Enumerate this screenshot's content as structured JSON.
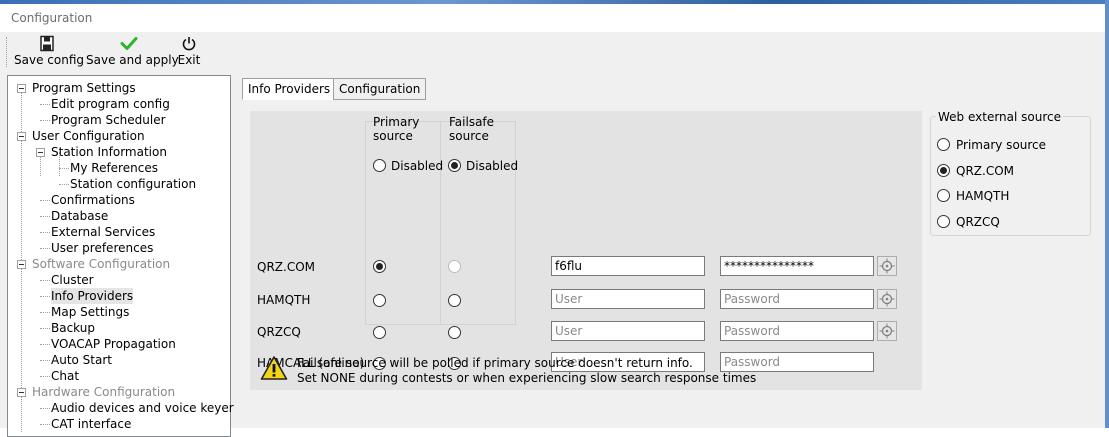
{
  "window": {
    "title": "Configuration"
  },
  "toolbar": {
    "save_config": {
      "label": "Save config",
      "icon": "floppy-icon"
    },
    "save_apply": {
      "label": "Save and apply",
      "icon": "checkmark-icon"
    },
    "exit": {
      "label": "Exit",
      "icon": "power-icon"
    }
  },
  "tree": {
    "program_settings": "Program Settings",
    "edit_program_config": "Edit program config",
    "program_scheduler": "Program Scheduler",
    "user_configuration": "User Configuration",
    "station_information": "Station Information",
    "my_references": "My References",
    "station_configuration": "Station configuration",
    "confirmations": "Confirmations",
    "database": "Database",
    "external_services": "External Services",
    "user_preferences": "User preferences",
    "software_configuration": "Software Configuration",
    "cluster": "Cluster",
    "info_providers": "Info Providers",
    "map_settings": "Map Settings",
    "backup": "Backup",
    "voacap_propagation": "VOACAP Propagation",
    "auto_start": "Auto Start",
    "chat": "Chat",
    "hardware_configuration": "Hardware Configuration",
    "audio_devices": "Audio devices and voice keyer",
    "cat_interface": "CAT interface"
  },
  "tabs": {
    "info_providers": "Info Providers",
    "configuration": "Configuration"
  },
  "providers": {
    "primary_header": "Primary\nsource",
    "failsafe_header": "Failsafe\nsource",
    "primary_disabled": "Disabled",
    "failsafe_disabled": "Disabled",
    "rows": [
      {
        "name": "QRZ.COM",
        "user": "f6flu",
        "password": "***************"
      },
      {
        "name": "HAMQTH",
        "user_placeholder": "User",
        "password_placeholder": "Password"
      },
      {
        "name": "QRZCQ",
        "user_placeholder": "User",
        "password_placeholder": "Password"
      },
      {
        "name": "HAMCALL (online)",
        "user_placeholder": "User",
        "password_placeholder": "Password"
      }
    ],
    "note_line1": "Failsafe source will be polled if primary source doesn't return info.",
    "note_line2": "Set NONE during contests or when experiencing slow search response times"
  },
  "web_source": {
    "title": "Web external source",
    "options": [
      "Primary source",
      "QRZ.COM",
      "HAMQTH",
      "QRZCQ"
    ],
    "selected": "QRZ.COM"
  }
}
